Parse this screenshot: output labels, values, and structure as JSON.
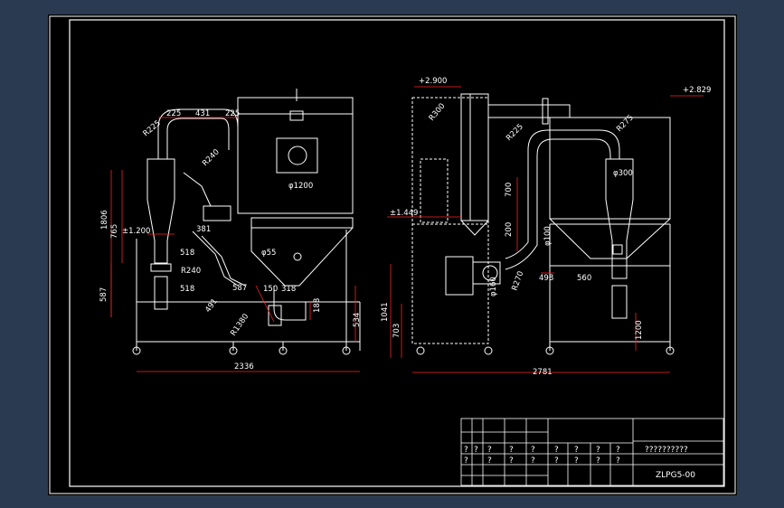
{
  "drawing": {
    "frame_color": "#ffffff",
    "dim_color": "#ff0000",
    "pipe_color": "#ffffff",
    "hidden_color": "#ffffff",
    "bg_color": "#000000",
    "outer_bg": "#2a3b51"
  },
  "left_view": {
    "top_dims": [
      "225",
      "431",
      "225"
    ],
    "radii": [
      "R225",
      "R240"
    ],
    "diam_1200": "φ1200",
    "diam_55": "φ55",
    "height_1806": "1806",
    "height_765": "765",
    "height_587": "587",
    "elev": "±1.200",
    "d518a": "518",
    "d518b": "518",
    "r240b": "R240",
    "d587b": "587",
    "d150": "150",
    "d318": "318",
    "d188": "188",
    "d534": "534",
    "d491": "491",
    "d381": "381",
    "r1380": "R1380",
    "width": "2336"
  },
  "right_view": {
    "elev_top_left": "+2.900",
    "elev_top_right": "+2.829",
    "elev_mid": "±1.449",
    "r300": "R300",
    "r225": "R225",
    "r275": "R275",
    "d700": "700",
    "d200": "200",
    "d300": "φ300",
    "d100": "φ100",
    "d160": "φ160",
    "r270": "R270",
    "d498": "498",
    "d560": "560",
    "d1041": "1041",
    "d703": "703",
    "d1200": "1200",
    "width": "2781"
  },
  "title_block": {
    "title": "??????????",
    "drawing_no": "ZLPG5-00",
    "row_a": [
      "?",
      "?",
      "?",
      "?",
      "?",
      "?",
      "?",
      "?",
      "?"
    ],
    "row_b": [
      "?",
      "?",
      "?",
      "?",
      "?",
      "?",
      "?",
      "?"
    ]
  }
}
